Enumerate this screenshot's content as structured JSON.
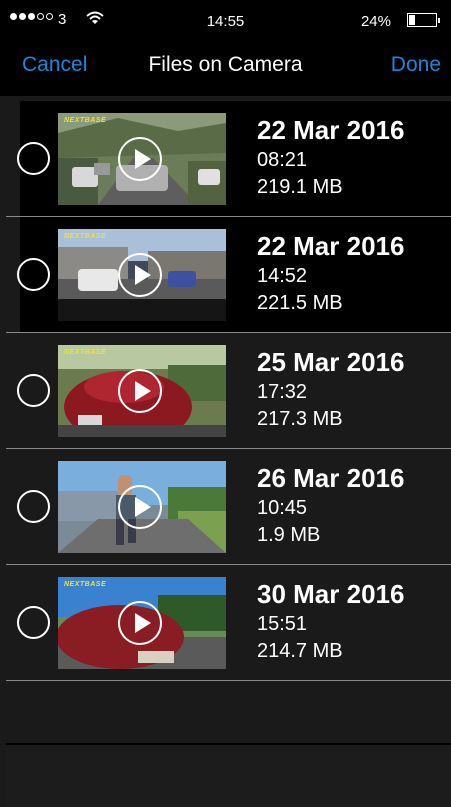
{
  "status": {
    "carrier": "3",
    "time": "14:55",
    "battery": "24%"
  },
  "nav": {
    "cancel": "Cancel",
    "title": "Files on Camera",
    "done": "Done"
  },
  "brand_mark": "NEXTBASE",
  "files": [
    {
      "date": "22 Mar 2016",
      "time": "08:21",
      "size": "219.1 MB"
    },
    {
      "date": "22 Mar 2016",
      "time": "14:52",
      "size": "221.5 MB"
    },
    {
      "date": "25 Mar 2016",
      "time": "17:32",
      "size": "217.3 MB"
    },
    {
      "date": "26 Mar 2016",
      "time": "10:45",
      "size": "1.9 MB"
    },
    {
      "date": "30 Mar 2016",
      "time": "15:51",
      "size": "214.7 MB"
    }
  ],
  "colors": {
    "accent": "#1a88d8",
    "background": "#1a1a1a"
  }
}
